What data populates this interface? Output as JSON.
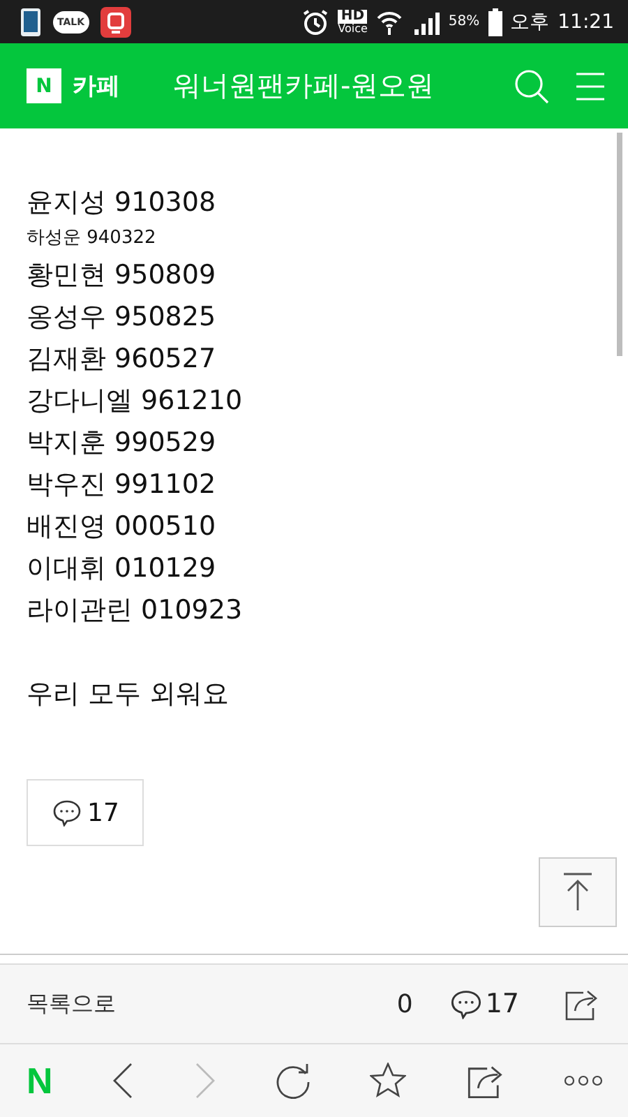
{
  "status_bar": {
    "hd": "HD",
    "voice": "Voice",
    "battery": "58%",
    "ampm": "오후",
    "time": "11:21",
    "talk": "TALK"
  },
  "header": {
    "logo_letter": "N",
    "logo_label": "카페",
    "title": "워너원팬카페-원오원"
  },
  "post": {
    "lines": [
      {
        "kind": "normal",
        "text": "윤지성 910308"
      },
      {
        "kind": "small",
        "text": "하성운 940322"
      },
      {
        "kind": "normal",
        "text": "황민현 950809"
      },
      {
        "kind": "normal",
        "text": "옹성우 950825"
      },
      {
        "kind": "normal",
        "text": "김재환 960527"
      },
      {
        "kind": "normal",
        "text": "강다니엘 961210"
      },
      {
        "kind": "normal",
        "text": "박지훈 990529"
      },
      {
        "kind": "normal",
        "text": "박우진 991102"
      },
      {
        "kind": "normal",
        "text": "배진영 000510"
      },
      {
        "kind": "normal",
        "text": "이대휘 010129"
      },
      {
        "kind": "normal",
        "text": "라이관린 010923"
      },
      {
        "kind": "gap"
      },
      {
        "kind": "normal",
        "text": "우리 모두 외워요"
      }
    ],
    "comment_count": "17"
  },
  "action_bar": {
    "list_link": "목록으로",
    "likes": "0",
    "comments": "17"
  },
  "browser_bar": {
    "logo_letter": "N",
    "back_disabled": false,
    "forward_disabled": true
  }
}
